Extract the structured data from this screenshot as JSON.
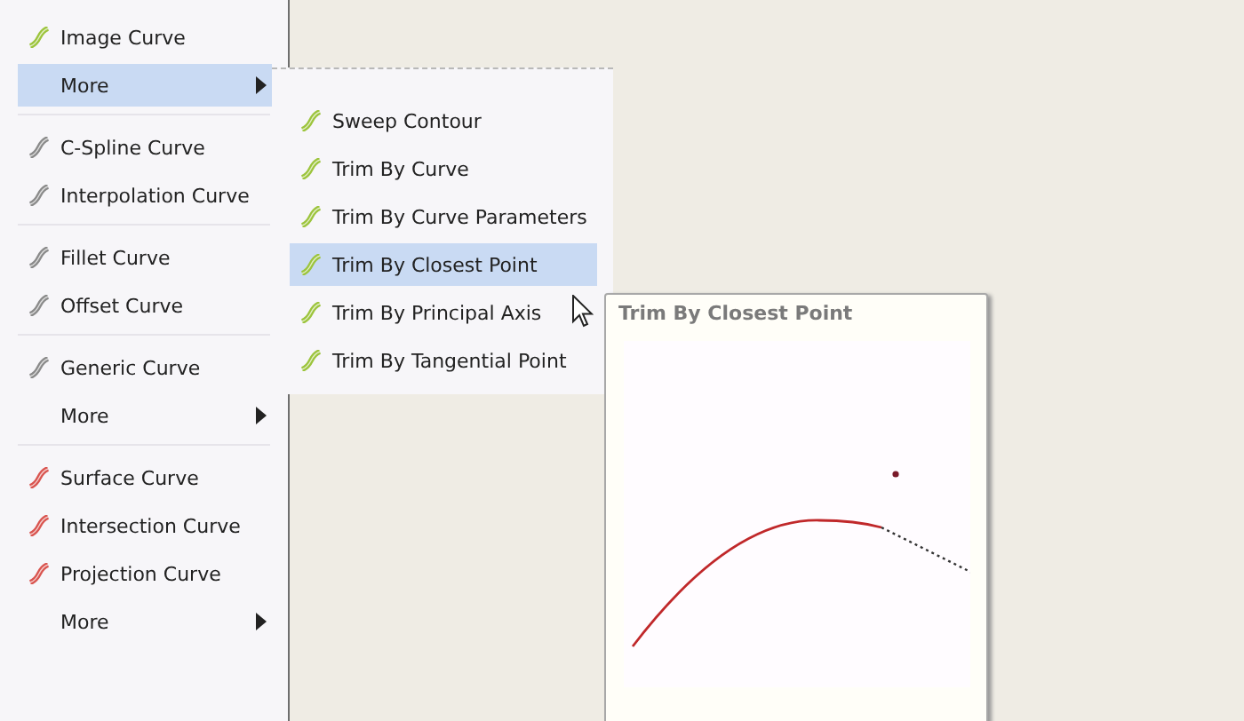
{
  "menu": {
    "groups": [
      {
        "items": [
          {
            "label": "Image Curve",
            "color": "#9cc43c",
            "selected": false,
            "submenu": false
          },
          {
            "label": "More",
            "selected": true,
            "submenu": true
          }
        ]
      },
      {
        "items": [
          {
            "label": "C-Spline Curve",
            "color": "#8a8a8a",
            "selected": false,
            "submenu": false
          },
          {
            "label": "Interpolation Curve",
            "color": "#8a8a8a",
            "selected": false,
            "submenu": false
          }
        ]
      },
      {
        "items": [
          {
            "label": "Fillet Curve",
            "color": "#8a8a8a",
            "selected": false,
            "submenu": false
          },
          {
            "label": "Offset Curve",
            "color": "#8a8a8a",
            "selected": false,
            "submenu": false
          }
        ]
      },
      {
        "items": [
          {
            "label": "Generic Curve",
            "color": "#8a8a8a",
            "selected": false,
            "submenu": false
          },
          {
            "label": "More",
            "selected": false,
            "submenu": true
          }
        ]
      },
      {
        "items": [
          {
            "label": "Surface Curve",
            "color": "#d9544f",
            "selected": false,
            "submenu": false
          },
          {
            "label": "Intersection Curve",
            "color": "#d9544f",
            "selected": false,
            "submenu": false
          },
          {
            "label": "Projection Curve",
            "color": "#d9544f",
            "selected": false,
            "submenu": false
          },
          {
            "label": "More",
            "selected": false,
            "submenu": true
          }
        ]
      }
    ]
  },
  "submenu": {
    "items": [
      {
        "label": "Sweep Contour",
        "color": "#9cc43c",
        "selected": false
      },
      {
        "label": "Trim By Curve",
        "color": "#9cc43c",
        "selected": false
      },
      {
        "label": "Trim By Curve Parameters",
        "color": "#9cc43c",
        "selected": false
      },
      {
        "label": "Trim By Closest Point",
        "color": "#9cc43c",
        "selected": true
      },
      {
        "label": "Trim By Principal Axis",
        "color": "#9cc43c",
        "selected": false
      },
      {
        "label": "Trim By Tangential Point",
        "color": "#9cc43c",
        "selected": false
      }
    ]
  },
  "tooltip": {
    "title": "Trim By Closest Point"
  }
}
